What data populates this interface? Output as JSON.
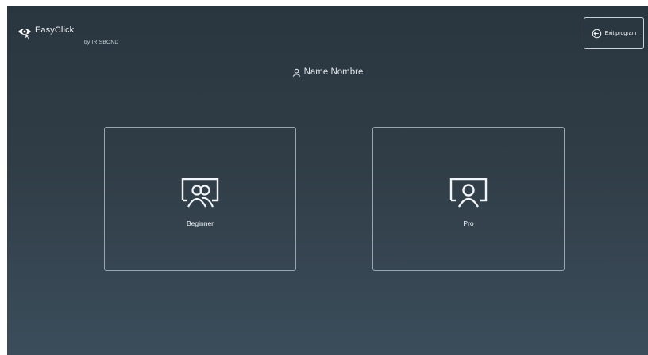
{
  "app": {
    "name": "EasyClick",
    "brand_sub": "by IRISBOND"
  },
  "header": {
    "exit_label": "Exit program",
    "user_name": "Name Nombre"
  },
  "modes": [
    {
      "label": "Beginner",
      "icon": "users-screen-icon"
    },
    {
      "label": "Pro",
      "icon": "user-screen-icon"
    }
  ],
  "colors": {
    "background_top": "#2a363f",
    "background_bottom": "#3b4d5b",
    "text": "#f2f5f7",
    "card_border": "#9aa6af"
  }
}
